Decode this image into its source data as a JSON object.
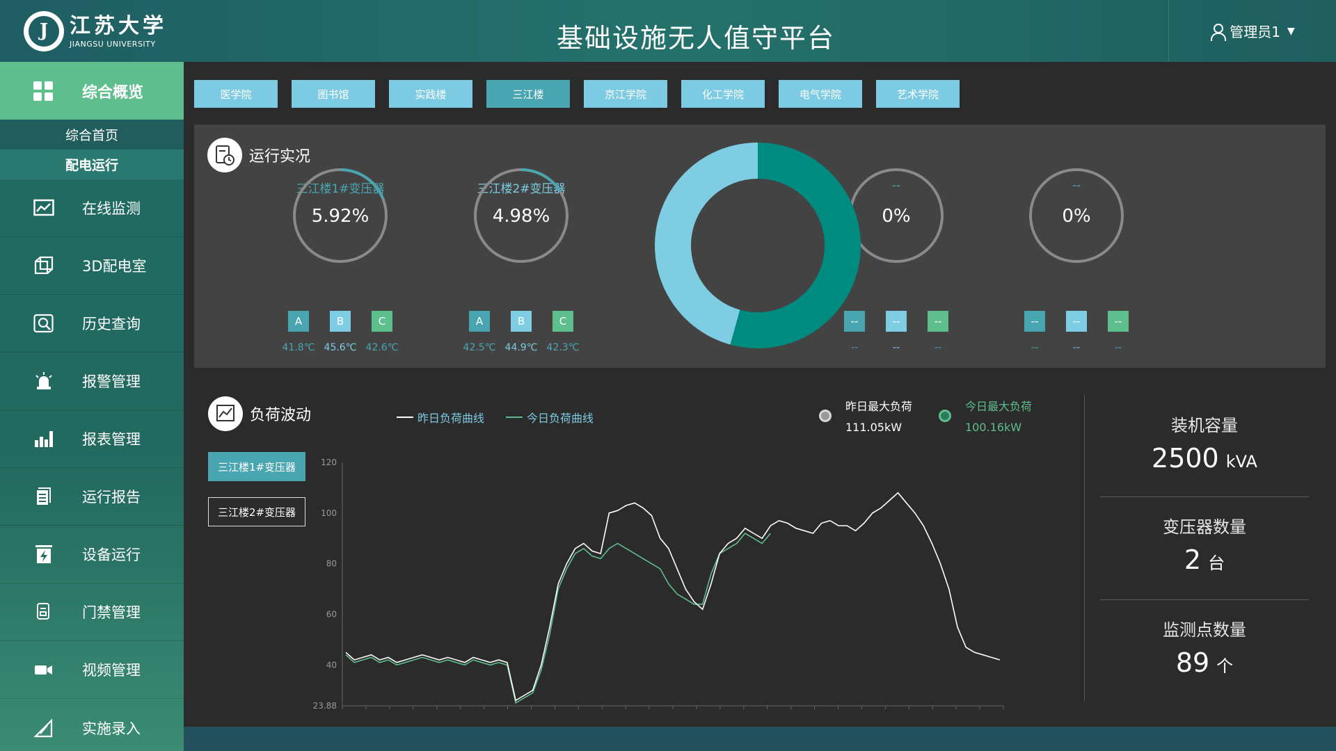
{
  "header": {
    "logo_cn": "江苏大学",
    "logo_en": "JIANGSU UNIVERSITY",
    "title": "基础设施无人值守平台",
    "user": "管理员1"
  },
  "sidebar": {
    "items": [
      {
        "label": "综合概览",
        "icon": "grid-icon",
        "active": true
      },
      {
        "label": "在线监测",
        "icon": "monitor-chart-icon"
      },
      {
        "label": "3D配电室",
        "icon": "cube-3d-icon"
      },
      {
        "label": "历史查询",
        "icon": "search-history-icon"
      },
      {
        "label": "报警管理",
        "icon": "alarm-light-icon"
      },
      {
        "label": "报表管理",
        "icon": "bar-chart-icon"
      },
      {
        "label": "运行报告",
        "icon": "report-document-icon"
      },
      {
        "label": "设备运行",
        "icon": "power-device-icon"
      },
      {
        "label": "门禁管理",
        "icon": "access-card-icon"
      },
      {
        "label": "视频管理",
        "icon": "video-camera-icon"
      },
      {
        "label": "实施录入",
        "icon": "pen-edit-icon"
      }
    ],
    "subitems": [
      {
        "label": "综合首页",
        "active": false
      },
      {
        "label": "配电运行",
        "active": true
      }
    ]
  },
  "tabs": [
    "医学院",
    "图书馆",
    "实践楼",
    "三江楼",
    "京江学院",
    "化工学院",
    "电气学院",
    "艺术学院"
  ],
  "active_tab": 3,
  "operation": {
    "title": "运行实况",
    "gauges": [
      {
        "title": "三江楼1#变压器",
        "value": "5.92%",
        "percent": 5.92,
        "phases": [
          "A",
          "B",
          "C"
        ],
        "temps": [
          "41.8℃",
          "45.6℃",
          "42.6℃"
        ]
      },
      {
        "title": "三江楼2#变压器",
        "value": "4.98%",
        "percent": 4.98,
        "phases": [
          "A",
          "B",
          "C"
        ],
        "temps": [
          "42.5℃",
          "44.9℃",
          "42.3℃"
        ]
      },
      {
        "title": "--",
        "value": "0%",
        "percent": 0,
        "phases": [
          "--",
          "--",
          "--"
        ],
        "temps": [
          "--",
          "--",
          "--"
        ]
      },
      {
        "title": "--",
        "value": "0%",
        "percent": 0,
        "phases": [
          "--",
          "--",
          "--"
        ],
        "temps": [
          "--",
          "--",
          "--"
        ]
      }
    ],
    "donut": {
      "slices": [
        {
          "value": 54.3,
          "color": "#008b80"
        },
        {
          "value": 45.7,
          "color": "#7ecde3"
        }
      ]
    }
  },
  "load": {
    "title": "负荷波动",
    "legend_yesterday": "昨日负荷曲线",
    "legend_today": "今日负荷曲线",
    "yesterday_max_label": "昨日最大负荷",
    "yesterday_max_value": "111.05kW",
    "today_max_label": "今日最大负荷",
    "today_max_value": "100.16kW",
    "buttons": [
      "三江楼1#变压器",
      "三江楼2#变压器"
    ]
  },
  "stats": {
    "capacity_label": "装机容量",
    "capacity_value": "2500",
    "capacity_unit": "kVA",
    "transformer_label": "变压器数量",
    "transformer_value": "2",
    "transformer_unit": "台",
    "points_label": "监测点数量",
    "points_value": "89",
    "points_unit": "个"
  },
  "colors": {
    "accent": "#5fbe8e",
    "teal": "#008b80",
    "light_blue": "#7ecde3",
    "phase_a": "#49a6b1",
    "phase_b": "#7ecde3",
    "phase_c": "#5fbe8e"
  },
  "chart_data": {
    "type": "line",
    "y_ticks": [
      "120",
      "100",
      "80",
      "60",
      "40",
      "23.88"
    ],
    "ylim": [
      23.88,
      120
    ],
    "series": [
      {
        "name": "昨日负荷曲线",
        "color": "#ffffff",
        "values": [
          45,
          42,
          43,
          44,
          42,
          43,
          41,
          42,
          43,
          44,
          43,
          42,
          43,
          42,
          41,
          43,
          42,
          41,
          42,
          41,
          26,
          28,
          30,
          40,
          55,
          72,
          80,
          86,
          88,
          85,
          84,
          100,
          101,
          103,
          104,
          102,
          99,
          90,
          86,
          78,
          70,
          65,
          62,
          72,
          84,
          88,
          90,
          94,
          92,
          90,
          95,
          97,
          96,
          94,
          93,
          92,
          96,
          97,
          95,
          95,
          93,
          96,
          100,
          102,
          105,
          108,
          104,
          100,
          95,
          88,
          80,
          70,
          55,
          47,
          45,
          44,
          43,
          42
        ]
      },
      {
        "name": "今日负荷曲线",
        "color": "#5fbe8e",
        "values": [
          44,
          41,
          42,
          43,
          41,
          42,
          40,
          41,
          42,
          43,
          42,
          41,
          42,
          41,
          40,
          42,
          41,
          40,
          41,
          40,
          25,
          27,
          29,
          38,
          52,
          70,
          78,
          84,
          86,
          83,
          82,
          86,
          88,
          86,
          84,
          82,
          80,
          78,
          72,
          68,
          66,
          64,
          64,
          76,
          84,
          86,
          88,
          92,
          90,
          88,
          92
        ]
      }
    ]
  }
}
